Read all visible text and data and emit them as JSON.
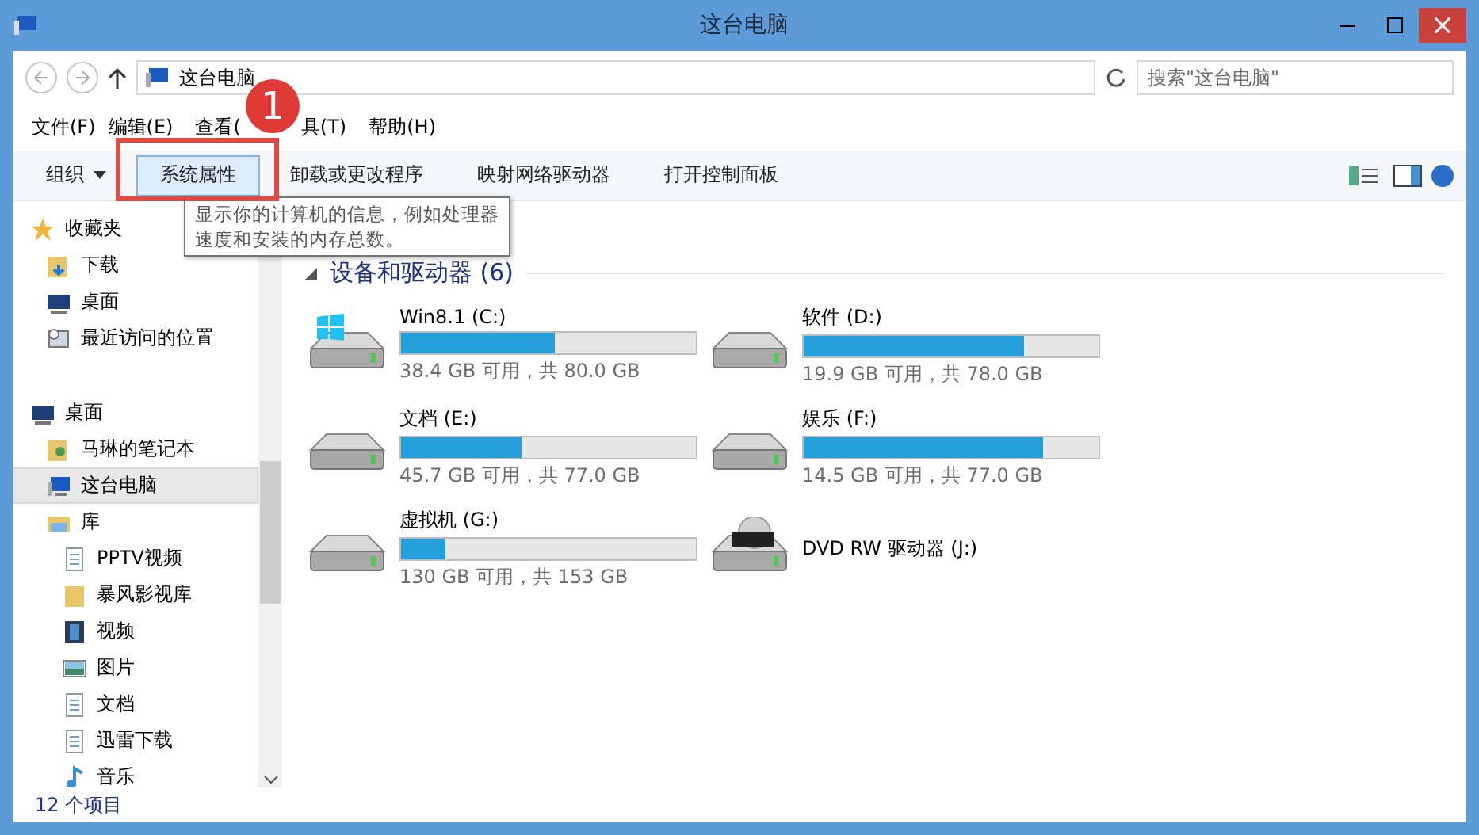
{
  "window": {
    "title": "这台电脑"
  },
  "address": {
    "path": [
      "这台电脑"
    ],
    "search_placeholder": "搜索\"这台电脑\""
  },
  "menu": [
    "文件(F)",
    "编辑(E)",
    "查看(",
    "具(T)",
    "帮助(H)"
  ],
  "toolbar": [
    {
      "label": "组织",
      "kind": "dropdown",
      "selected": false
    },
    {
      "label": "系统属性",
      "kind": "button",
      "selected": true
    },
    {
      "label": "卸载或更改程序",
      "kind": "button",
      "selected": false
    },
    {
      "label": "映射网络驱动器",
      "kind": "button",
      "selected": false
    },
    {
      "label": "打开控制面板",
      "kind": "button",
      "selected": false
    }
  ],
  "tooltip": "显示你的计算机的信息，例如处理器速度和安装的内存总数。",
  "annotation": {
    "number": "1"
  },
  "sidebar": {
    "items": [
      {
        "label": "收藏夹",
        "kind": "star",
        "selected": false,
        "children": [
          {
            "label": "下载",
            "kind": "download",
            "selected": false
          },
          {
            "label": "桌面",
            "kind": "desktop",
            "selected": false
          },
          {
            "label": "最近访问的位置",
            "kind": "recent",
            "selected": false
          }
        ]
      },
      {
        "label": "桌面",
        "kind": "desktop",
        "selected": false,
        "children": [
          {
            "label": "马琳的笔记本",
            "kind": "user",
            "selected": false
          },
          {
            "label": "这台电脑",
            "kind": "computer",
            "selected": true
          },
          {
            "label": "库",
            "kind": "library",
            "selected": false,
            "children": [
              {
                "label": "PPTV视频",
                "kind": "doc",
                "selected": false
              },
              {
                "label": "暴风影视库",
                "kind": "folder",
                "selected": false
              },
              {
                "label": "视频",
                "kind": "video",
                "selected": false
              },
              {
                "label": "图片",
                "kind": "image",
                "selected": false
              },
              {
                "label": "文档",
                "kind": "doc",
                "selected": false
              },
              {
                "label": "迅雷下载",
                "kind": "doc",
                "selected": false
              },
              {
                "label": "音乐",
                "kind": "music",
                "selected": false
              }
            ]
          }
        ]
      }
    ]
  },
  "group": {
    "title": "设备和驱动器 (6)",
    "expanded": true
  },
  "drives": [
    {
      "name": "Win8.1 (C:)",
      "kind": "system",
      "level": 0.52,
      "space": "38.4 GB 可用，共 80.0 GB"
    },
    {
      "name": "软件 (D:)",
      "kind": "hdd",
      "level": 0.745,
      "space": "19.9 GB 可用，共 78.0 GB"
    },
    {
      "name": "文档 (E:)",
      "kind": "hdd",
      "level": 0.406,
      "space": "45.7 GB 可用，共 77.0 GB"
    },
    {
      "name": "娱乐 (F:)",
      "kind": "hdd",
      "level": 0.81,
      "space": "14.5 GB 可用，共 77.0 GB"
    },
    {
      "name": "虚拟机 (G:)",
      "kind": "hdd",
      "level": 0.15,
      "space": "130 GB 可用，共 153 GB"
    },
    {
      "name": "DVD RW 驱动器 (J:)",
      "kind": "dvd"
    }
  ],
  "status_bar": {
    "count": "12 个项目"
  }
}
